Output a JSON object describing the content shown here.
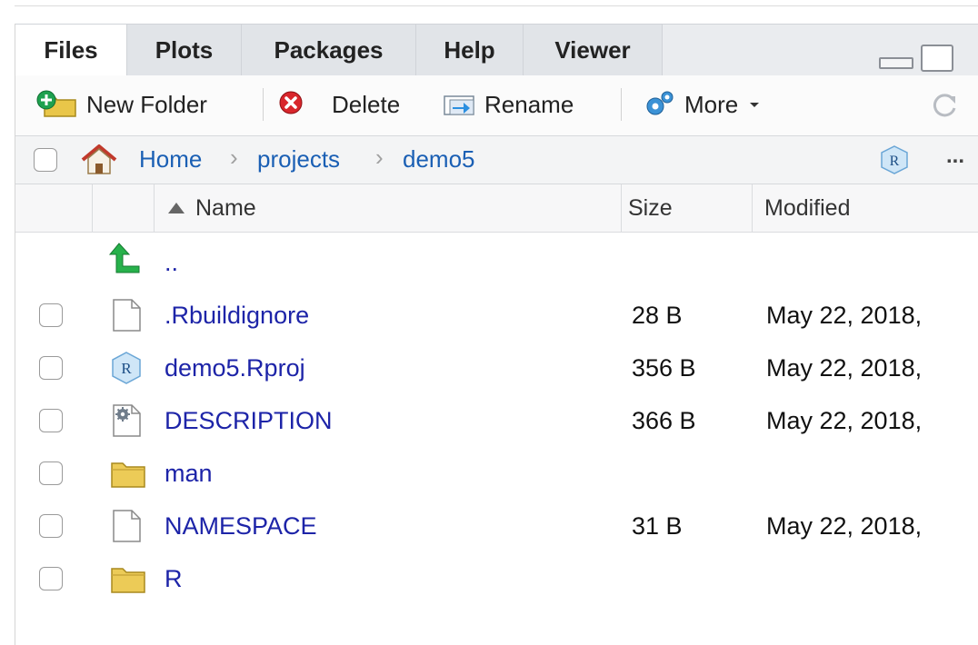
{
  "tabs": [
    {
      "label": "Files",
      "active": true
    },
    {
      "label": "Plots",
      "active": false
    },
    {
      "label": "Packages",
      "active": false
    },
    {
      "label": "Help",
      "active": false
    },
    {
      "label": "Viewer",
      "active": false
    }
  ],
  "toolbar": {
    "new_folder": "New Folder",
    "delete": "Delete",
    "rename": "Rename",
    "more": "More"
  },
  "breadcrumb": {
    "home": "Home",
    "projects": "projects",
    "current": "demo5",
    "more": "..."
  },
  "columns": {
    "name": "Name",
    "size": "Size",
    "modified": "Modified"
  },
  "parent_dir": "..",
  "files": [
    {
      "name": ".Rbuildignore",
      "size": "28 B",
      "modified": "May 22, 2018,",
      "icon": "file-icon"
    },
    {
      "name": "demo5.Rproj",
      "size": "356 B",
      "modified": "May 22, 2018,",
      "icon": "rproj-icon"
    },
    {
      "name": "DESCRIPTION",
      "size": "366 B",
      "modified": "May 22, 2018,",
      "icon": "config-file-icon"
    },
    {
      "name": "man",
      "size": "",
      "modified": "",
      "icon": "folder-icon"
    },
    {
      "name": "NAMESPACE",
      "size": "31 B",
      "modified": "May 22, 2018,",
      "icon": "file-icon"
    },
    {
      "name": "R",
      "size": "",
      "modified": "",
      "icon": "folder-icon"
    }
  ],
  "colors": {
    "link": "#1d24a8",
    "crumb": "#1a5fb4",
    "tab_bg": "#eaecef"
  }
}
